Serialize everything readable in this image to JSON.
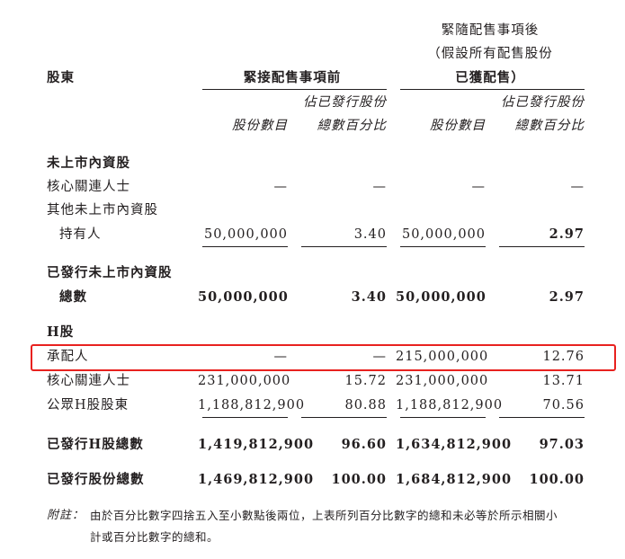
{
  "header": {
    "shareholders": "股東",
    "before_group": "緊接配售事項前",
    "after_group_l1": "緊隨配售事項後",
    "after_group_l2": "（假設所有配售股份",
    "after_group_l3": "已獲配售）",
    "pct_l1": "佔已發行股份",
    "pct_l2": "總數百分比",
    "shares_col": "股份數目"
  },
  "rows": {
    "unlisted_title": "未上市內資股",
    "core1_label": "核心關連人士",
    "core1": [
      "—",
      "—",
      "—",
      "—"
    ],
    "other_l1": "其他未上市內資股",
    "other_l2": "持有人",
    "other": [
      "50,000,000",
      "3.40",
      "50,000,000",
      "2.97"
    ],
    "unlisted_total_l1": "已發行未上市內資股",
    "unlisted_total_l2": "總數",
    "unlisted_total": [
      "50,000,000",
      "3.40",
      "50,000,000",
      "2.97"
    ],
    "h_title": "H股",
    "placee_label": "承配人",
    "placee": [
      "—",
      "—",
      "215,000,000",
      "12.76"
    ],
    "core2_label": "核心關連人士",
    "core2": [
      "231,000,000",
      "15.72",
      "231,000,000",
      "13.71"
    ],
    "public_label": "公眾H股股東",
    "public": [
      "1,188,812,900",
      "80.88",
      "1,188,812,900",
      "70.56"
    ],
    "h_total_label": "已發行H股總數",
    "h_total": [
      "1,419,812,900",
      "96.60",
      "1,634,812,900",
      "97.03"
    ],
    "all_total_label": "已發行股份總數",
    "all_total": [
      "1,469,812,900",
      "100.00",
      "1,684,812,900",
      "100.00"
    ]
  },
  "note": {
    "label": "附註：",
    "line1": "由於百分比數字四捨五入至小數點後兩位，上表所列百分比數字的總和未必等於所示相關小",
    "line2": "計或百分比數字的總和。"
  },
  "highlight_color": "#e8211f"
}
